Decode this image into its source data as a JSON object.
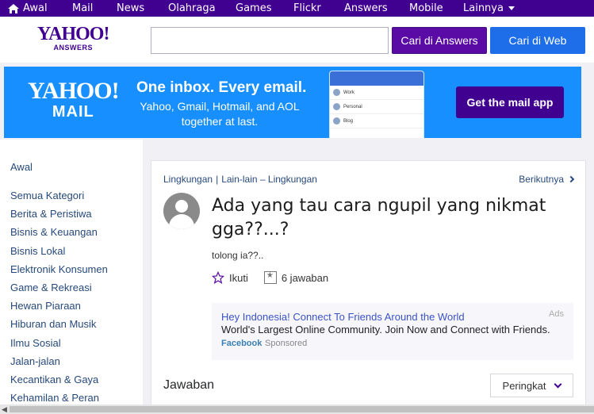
{
  "topnav": {
    "items": [
      "Awal",
      "Mail",
      "News",
      "Olahraga",
      "Games",
      "Flickr",
      "Answers",
      "Mobile",
      "Lainnya"
    ]
  },
  "header": {
    "logo_main": "YAHOO!",
    "logo_sub": "ANSWERS",
    "search_value": "",
    "btn_answers": "Cari di Answers",
    "btn_web": "Cari di Web"
  },
  "banner": {
    "logo_line1": "YAHOO!",
    "logo_line2": "MAIL",
    "headline": "One inbox. Every email.",
    "sub": "Yahoo, Gmail, Hotmail, and AOL together at last.",
    "phone_rows": [
      "Work",
      "Personal",
      "Blog"
    ],
    "cta": "Get the mail app"
  },
  "sidebar": {
    "home": "Awal",
    "items": [
      "Semua Kategori",
      "Berita & Peristiwa",
      "Bisnis & Keuangan",
      "Bisnis Lokal",
      "Elektronik Konsumen",
      "Game & Rekreasi",
      "Hewan Piaraan",
      "Hiburan dan Musik",
      "Ilmu Sosial",
      "Jalan-jalan",
      "Kecantikan & Gaya",
      "Kehamilan & Peran"
    ]
  },
  "question": {
    "crumb1": "Lingkungan",
    "crumb2": "Lain-lain – Lingkungan",
    "next": "Berikutnya",
    "title": "Ada yang tau cara ngupil yang nikmat gga??...?",
    "body": "tolong ia??..",
    "follow": "Ikuti",
    "answers_count": "6 jawaban"
  },
  "ad": {
    "title": "Hey Indonesia! Connect To Friends Around the World",
    "desc": "World's Largest Online Community. Join Now and Connect with Friends.",
    "source": "Facebook",
    "sponsored": "Sponsored",
    "tag": "Ads"
  },
  "answers_section": {
    "heading": "Jawaban",
    "sort": "Peringkat"
  },
  "colors": {
    "nav_bg": "#400090",
    "banner_bg": "#188fff",
    "answers_btn": "#5a0ba6",
    "web_btn": "#1d6ee8",
    "link": "#26497b"
  }
}
